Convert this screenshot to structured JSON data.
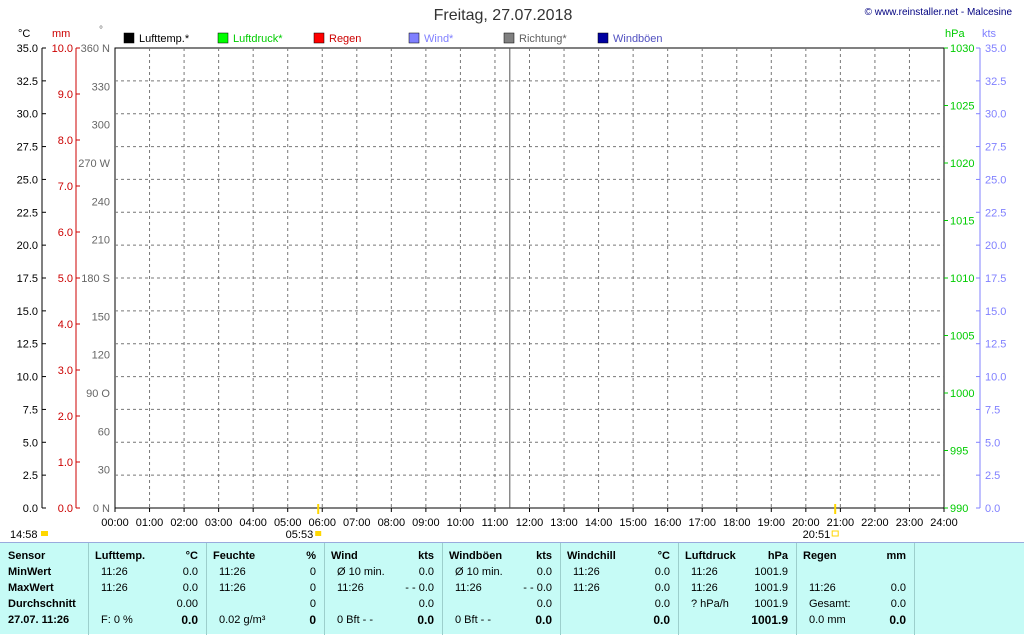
{
  "title": "Freitag, 27.07.2018",
  "copyright": "© www.reinstaller.net - Malcesine",
  "legend": [
    {
      "label": "Lufttemp.*",
      "color": "#000000",
      "text_color": "#000000"
    },
    {
      "label": "Luftdruck*",
      "color": "#00ff00",
      "text_color": "#00cc00"
    },
    {
      "label": "Regen",
      "color": "#ff0000",
      "text_color": "#cc0000"
    },
    {
      "label": "Wind*",
      "color": "#8080ff",
      "text_color": "#8080ff"
    },
    {
      "label": "Richtung*",
      "color": "#808080",
      "text_color": "#606060"
    },
    {
      "label": "Windböen",
      "color": "#0000a0",
      "text_color": "#5050c0"
    }
  ],
  "chart_data": {
    "type": "line",
    "axis_units": {
      "temp": "°C",
      "rain": "mm",
      "direction": "°",
      "pressure": "hPa",
      "wind": "kts"
    },
    "x_ticks": [
      "00:00",
      "01:00",
      "02:00",
      "03:00",
      "04:00",
      "05:00",
      "06:00",
      "07:00",
      "08:00",
      "09:00",
      "10:00",
      "11:00",
      "12:00",
      "13:00",
      "14:00",
      "15:00",
      "16:00",
      "17:00",
      "18:00",
      "19:00",
      "20:00",
      "21:00",
      "22:00",
      "23:00",
      "24:00"
    ],
    "temp_ticks": [
      "35.0",
      "32.5",
      "30.0",
      "27.5",
      "25.0",
      "22.5",
      "20.0",
      "17.5",
      "15.0",
      "12.5",
      "10.0",
      "7.5",
      "5.0",
      "2.5",
      "0.0"
    ],
    "rain_ticks": [
      "10.0",
      "9.0",
      "8.0",
      "7.0",
      "6.0",
      "5.0",
      "4.0",
      "3.0",
      "2.0",
      "1.0",
      "0.0"
    ],
    "direction_ticks": [
      "360 N",
      "330",
      "300",
      "270 W",
      "240",
      "210",
      "180 S",
      "150",
      "120",
      "90  O",
      "60",
      "30",
      "0 N"
    ],
    "pressure_ticks": [
      "1030",
      "1025",
      "1020",
      "1015",
      "1010",
      "1005",
      "1000",
      "995",
      "990"
    ],
    "wind_ticks": [
      "35.0",
      "32.5",
      "30.0",
      "27.5",
      "25.0",
      "22.5",
      "20.0",
      "17.5",
      "15.0",
      "12.5",
      "10.0",
      "7.5",
      "5.0",
      "2.5",
      "0.0"
    ],
    "temp_range": [
      0,
      35
    ],
    "rain_range": [
      0,
      10
    ],
    "direction_range": [
      0,
      360
    ],
    "pressure_range": [
      990,
      1030
    ],
    "wind_range": [
      0,
      35
    ],
    "current_time_hour": 11.43,
    "sunrise_hour": 5.883,
    "sunset_hour": 20.85,
    "sunrise_label": "05:53",
    "sunset_label": "20:51",
    "daylength_label": "14:58",
    "series": [],
    "grid": true
  },
  "stats": {
    "sensor": {
      "header": "Sensor",
      "rows": [
        "MinWert",
        "MaxWert",
        "Durchschnitt",
        "27.07. 11:26"
      ]
    },
    "lufttemp": {
      "header": "Lufttemp.",
      "unit": "°C",
      "rows": [
        [
          "11:26",
          "0.0"
        ],
        [
          "11:26",
          "0.0"
        ],
        [
          "",
          "0.00"
        ],
        [
          "F: 0 %",
          "0.0"
        ]
      ]
    },
    "feuchte": {
      "header": "Feuchte",
      "unit": "%",
      "rows": [
        [
          "11:26",
          "0"
        ],
        [
          "11:26",
          "0"
        ],
        [
          "",
          "0"
        ],
        [
          "0.02 g/m³",
          "0"
        ]
      ]
    },
    "wind": {
      "header": "Wind",
      "unit": "kts",
      "rows": [
        [
          "Ø 10 min.",
          "0.0"
        ],
        [
          "11:26",
          "- - 0.0"
        ],
        [
          "",
          "0.0"
        ],
        [
          "0 Bft - -",
          "0.0"
        ]
      ]
    },
    "windboeen": {
      "header": "Windböen",
      "unit": "kts",
      "rows": [
        [
          "Ø 10 min.",
          "0.0"
        ],
        [
          "11:26",
          "- - 0.0"
        ],
        [
          "",
          "0.0"
        ],
        [
          "0 Bft - -",
          "0.0"
        ]
      ]
    },
    "windchill": {
      "header": "Windchill",
      "unit": "°C",
      "rows": [
        [
          "11:26",
          "0.0"
        ],
        [
          "11:26",
          "0.0"
        ],
        [
          "",
          "0.0"
        ],
        [
          "",
          "0.0"
        ]
      ]
    },
    "luftdruck": {
      "header": "Luftdruck",
      "unit": "hPa",
      "rows": [
        [
          "11:26",
          "1001.9"
        ],
        [
          "11:26",
          "1001.9"
        ],
        [
          "? hPa/h",
          "1001.9"
        ],
        [
          "",
          "1001.9"
        ]
      ]
    },
    "regen": {
      "header": "Regen",
      "unit": "mm",
      "rows": [
        [
          "",
          ""
        ],
        [
          "11:26",
          "0.0"
        ],
        [
          "Gesamt:",
          "0.0"
        ],
        [
          "0.0 mm",
          "0.0"
        ]
      ]
    }
  }
}
